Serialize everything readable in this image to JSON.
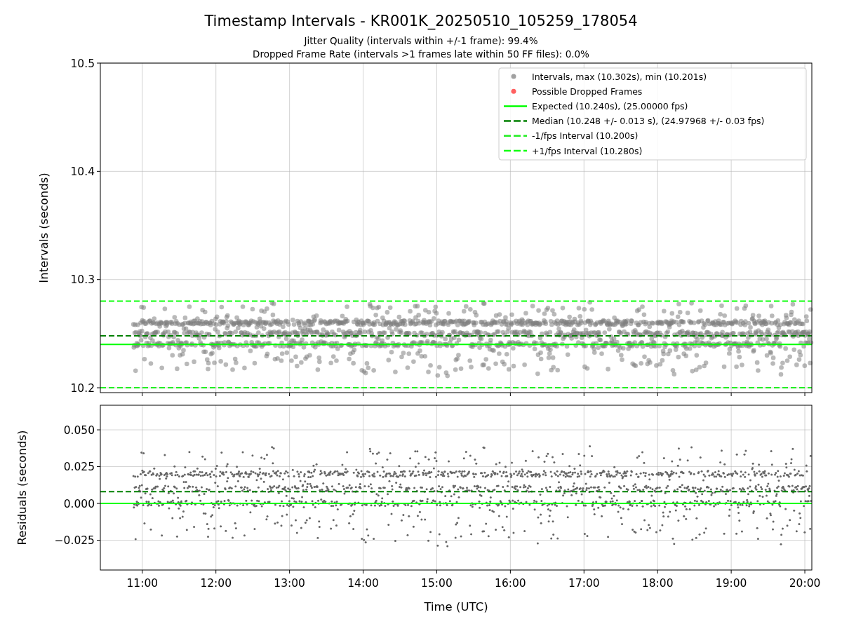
{
  "title": "Timestamp Intervals - KR001K_20250510_105259_178054",
  "subtitles": [
    "Jitter Quality (intervals within +/-1 frame): 99.4%",
    "Dropped Frame Rate (intervals >1 frames late within 50 FF files): 0.0%"
  ],
  "top_plot": {
    "legend_markers": [
      {
        "label": "Intervals, max (10.302s), min (10.201s)",
        "color": "#a0a0a0"
      },
      {
        "label": "Possible Dropped Frames",
        "color": "#ff6060"
      }
    ],
    "chart_data": {
      "type": "line",
      "grid": true,
      "ylabel": "Intervals (seconds)",
      "x": [
        10.43,
        20.095
      ],
      "xlim": [
        10.43,
        20.095
      ],
      "ylim": [
        10.1955,
        10.5
      ],
      "yticks": [
        {
          "value": 10.2,
          "label": "10.2"
        },
        {
          "value": 10.3,
          "label": "10.3"
        },
        {
          "value": 10.4,
          "label": "10.4"
        },
        {
          "value": 10.5,
          "label": "10.5"
        }
      ],
      "series": [
        {
          "name": "Expected (10.240s), (25.00000 fps)",
          "color": "#00ff00",
          "line_style": "solid",
          "values": [
            10.24,
            10.24
          ]
        },
        {
          "name": "Median (10.248 +/- 0.013 s), (24.97968 +/- 0.03 fps)",
          "color": "#008000",
          "line_style": "dashed",
          "values": [
            10.248,
            10.248
          ]
        },
        {
          "name": "-1/fps Interval (10.200s)",
          "color": "#22ee22",
          "line_style": "dashed",
          "values": [
            10.2,
            10.2
          ]
        },
        {
          "name": "+1/fps Interval (10.280s)",
          "color": "#11ff11",
          "line_style": "dashed",
          "values": [
            10.28,
            10.28
          ]
        }
      ]
    }
  },
  "bottom_plot": {
    "chart_data": {
      "type": "line",
      "grid": true,
      "xlabel": "Time (UTC)",
      "ylabel": "Residuals (seconds)",
      "x": [
        10.43,
        20.095
      ],
      "xlim": [
        10.43,
        20.095
      ],
      "ylim": [
        -0.0452,
        0.0667
      ],
      "xticks": [
        {
          "value": 11,
          "label": "11:00"
        },
        {
          "value": 12,
          "label": "12:00"
        },
        {
          "value": 13,
          "label": "13:00"
        },
        {
          "value": 14,
          "label": "14:00"
        },
        {
          "value": 15,
          "label": "15:00"
        },
        {
          "value": 16,
          "label": "16:00"
        },
        {
          "value": 17,
          "label": "17:00"
        },
        {
          "value": 18,
          "label": "18:00"
        },
        {
          "value": 19,
          "label": "19:00"
        },
        {
          "value": 20,
          "label": "20:00"
        }
      ],
      "yticks": [
        {
          "value": 0.05,
          "label": "0.050"
        },
        {
          "value": 0.025,
          "label": "0.025"
        },
        {
          "value": 0,
          "label": "0.000"
        },
        {
          "value": -0.025,
          "label": "−0.025"
        }
      ],
      "series": [
        {
          "color": "#00ff00",
          "line_style": "solid",
          "values": [
            0,
            0
          ]
        },
        {
          "color": "#008000",
          "line_style": "dashed",
          "values": [
            0.008,
            0.008
          ]
        }
      ]
    }
  }
}
